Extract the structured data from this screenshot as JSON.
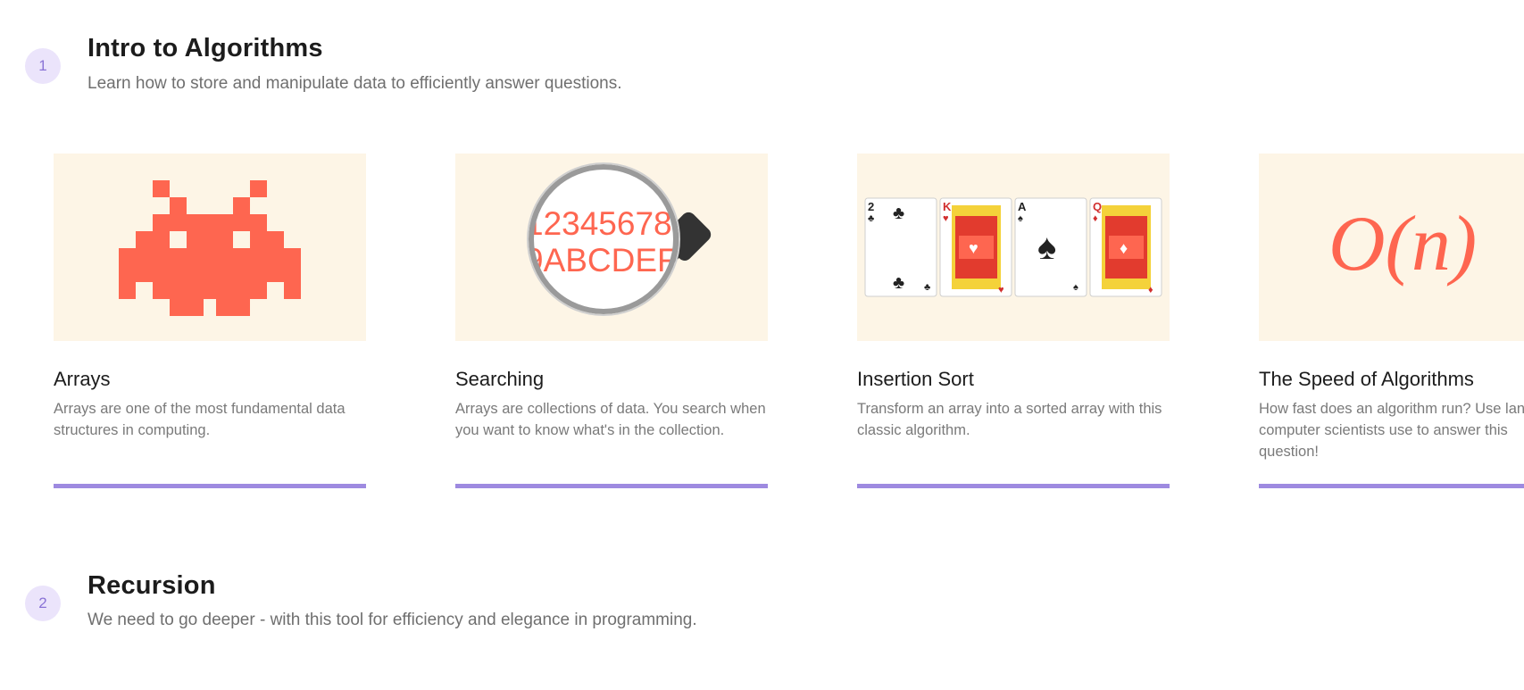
{
  "sections": [
    {
      "number": "1",
      "title": "Intro to Algorithms",
      "description": "Learn how to store and manipulate data to efficiently answer questions.",
      "cards": [
        {
          "title": "Arrays",
          "description": "Arrays are one of the most fundamental data structures in computing.",
          "image_icon": "space-invader-icon"
        },
        {
          "title": "Searching",
          "description": "Arrays are collections of data. You search when you want to know what's in the collection.",
          "image_icon": "magnifying-glass-icon",
          "image_text": [
            "12345678",
            "9ABCDEF"
          ]
        },
        {
          "title": "Insertion Sort",
          "description": "Transform an array into a sorted array with this classic algorithm.",
          "image_icon": "playing-cards-icon",
          "image_text": [
            "2",
            "K",
            "A",
            "Q"
          ]
        },
        {
          "title": "The Speed of Algorithms",
          "description": "How fast does an algorithm run? Use language computer scientists use to answer this question!",
          "image_icon": "big-o-notation-icon",
          "image_text": "O(n)"
        }
      ]
    },
    {
      "number": "2",
      "title": "Recursion",
      "description": "We need to go deeper - with this tool for efficiency and elegance in programming."
    }
  ],
  "colors": {
    "accent_purple": "#9e8ae0",
    "badge_bg": "#ebe4fb",
    "thumb_bg": "#fdf5e6",
    "illustration_red": "#fe6650"
  }
}
